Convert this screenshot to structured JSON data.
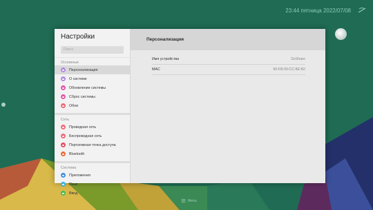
{
  "status": {
    "datetime": "23:44 пятница 2022/07/08"
  },
  "settings": {
    "title": "Настройки",
    "search_placeholder": "Поиск",
    "sections": [
      {
        "title": "Основные",
        "items": [
          {
            "label": "Персонализация",
            "color": "#b08adf",
            "active": true
          },
          {
            "label": "О системе",
            "color": "#b08adf"
          },
          {
            "label": "Обновление системы",
            "color": "#e056a8"
          },
          {
            "label": "Сброс системы",
            "color": "#e056a8"
          },
          {
            "label": "Обои",
            "color": "#ef6a74"
          }
        ]
      },
      {
        "title": "Сеть",
        "items": [
          {
            "label": "Проводная сеть",
            "color": "#ef6a74"
          },
          {
            "label": "Беспроводная сеть",
            "color": "#ef6a74"
          },
          {
            "label": "Портативная точка доступа",
            "color": "#e04f64"
          },
          {
            "label": "Bluetooth",
            "color": "#ee6a3a"
          }
        ]
      },
      {
        "title": "Система",
        "items": [
          {
            "label": "Приложения",
            "color": "#3b8fe0"
          },
          {
            "label": "Язык",
            "color": "#39b0e2"
          },
          {
            "label": "Ввод",
            "color": "#4dbb4f"
          }
        ]
      }
    ]
  },
  "panel": {
    "title": "Персонализация",
    "rows": [
      {
        "label": "Имя устройства",
        "value": "DzShare"
      },
      {
        "label": "MAC",
        "value": "60:FB:00:CC:8E:B2"
      }
    ]
  },
  "taskbar": {
    "menu_label": "Menu"
  }
}
